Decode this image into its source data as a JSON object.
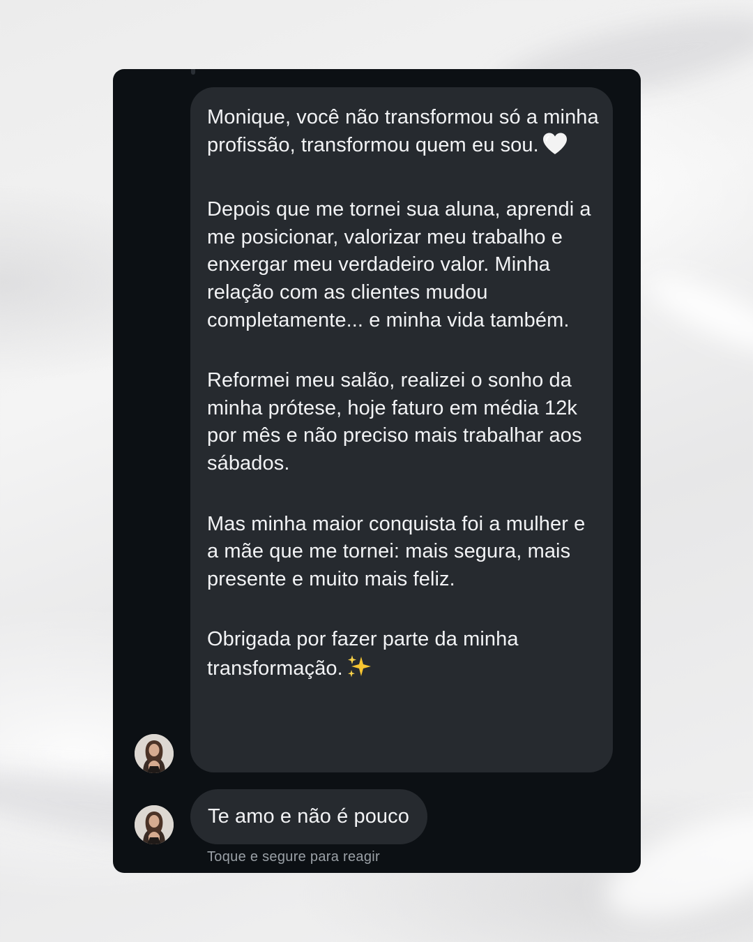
{
  "conversation": {
    "messages": [
      {
        "paragraphs": [
          "Monique, você não transformou só a minha profissão, transformou quem eu sou.",
          "Depois que me tornei sua aluna, aprendi a me posicionar, valorizar meu trabalho e enxergar meu verdadeiro valor. Minha relação com as clientes mudou completamente... e minha vida também.",
          "Reformei meu salão, realizei o sonho da minha prótese, hoje faturo em média 12k por mês e não preciso mais trabalhar aos sábados.",
          "Mas minha maior conquista foi a mulher e a mãe que me tornei: mais segura, mais presente e muito mais feliz.",
          "Obrigada por fazer parte da minha transformação."
        ],
        "emojis": {
          "heart": "white-heart-icon",
          "sparkles": "sparkles-icon"
        }
      },
      {
        "text": "Te amo e não é pouco"
      }
    ],
    "reaction_hint": "Toque e segure para reagir"
  },
  "colors": {
    "window_bg": "#0c1014",
    "bubble_bg": "#262a2f",
    "text": "#f2f3f5",
    "hint_text": "#9aa0a6"
  }
}
